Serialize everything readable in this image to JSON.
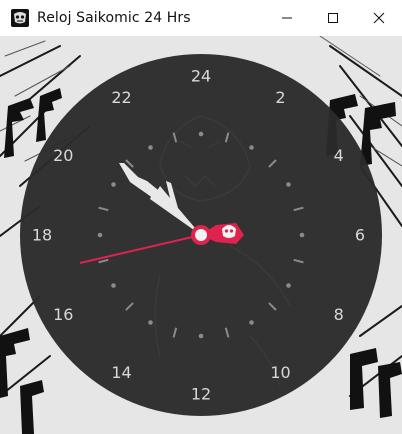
{
  "window": {
    "title": "Reloj Saikomic 24 Hrs",
    "controls": [
      "minimize",
      "maximize",
      "close"
    ]
  },
  "clock": {
    "format": "24h",
    "hour_labels": [
      "24",
      "2",
      "4",
      "6",
      "8",
      "10",
      "12",
      "14",
      "16",
      "18",
      "20",
      "22"
    ],
    "colors": {
      "face": "#2b2b2b",
      "numbers": "#d8d8d8",
      "ticks": "#8a8a8a",
      "hands": "#e8e8e8",
      "second_hand": "#e0234e",
      "hub": "#e0234e"
    },
    "icons": {
      "center_hub": "skull-icon"
    }
  }
}
